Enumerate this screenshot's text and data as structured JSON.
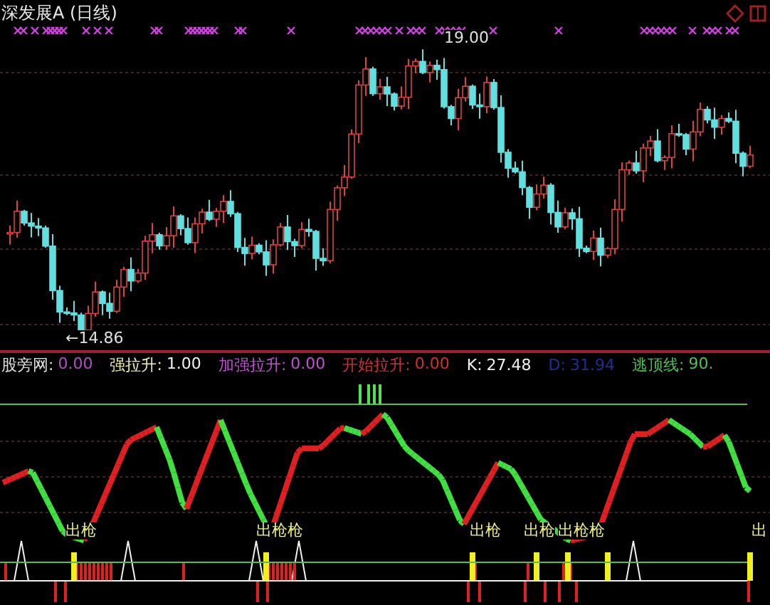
{
  "title": "深发展A (日线)",
  "price_labels": [
    {
      "text": "19.00",
      "kind": "high"
    },
    {
      "text": "←14.86",
      "kind": "low"
    }
  ],
  "legend": [
    {
      "label": {
        "text": "股旁网:",
        "color": "#e0e0e0"
      },
      "value": {
        "text": "0.00",
        "color": "#b050c0"
      }
    },
    {
      "label": {
        "text": "强拉升:",
        "color": "#f0f0b0"
      },
      "value": {
        "text": "1.00",
        "color": "#f0f0f0"
      }
    },
    {
      "label": {
        "text": "加强拉升:",
        "color": "#c050d0"
      },
      "value": {
        "text": "0.00",
        "color": "#c050d0"
      }
    },
    {
      "label": {
        "text": "开始拉升:",
        "color": "#d03030"
      },
      "value": {
        "text": "0.00",
        "color": "#d03030"
      }
    },
    {
      "label": {
        "text": "K:",
        "color": "#f0f0f0"
      },
      "value": {
        "text": "27.48",
        "color": "#f0f0f0"
      }
    },
    {
      "label": {
        "text": "D:",
        "color": "#203090"
      },
      "value": {
        "text": "31.94",
        "color": "#203090"
      }
    },
    {
      "label": {
        "text": "逃顶线:",
        "color": "#50c050"
      },
      "value": {
        "text": "90.",
        "color": "#50c050"
      }
    }
  ],
  "signals": [
    {
      "text": "出枪"
    },
    {
      "text": "出枪枪"
    },
    {
      "text": "出枪"
    },
    {
      "text": "出枪"
    },
    {
      "text": "出枪枪"
    },
    {
      "text": "出"
    }
  ]
}
